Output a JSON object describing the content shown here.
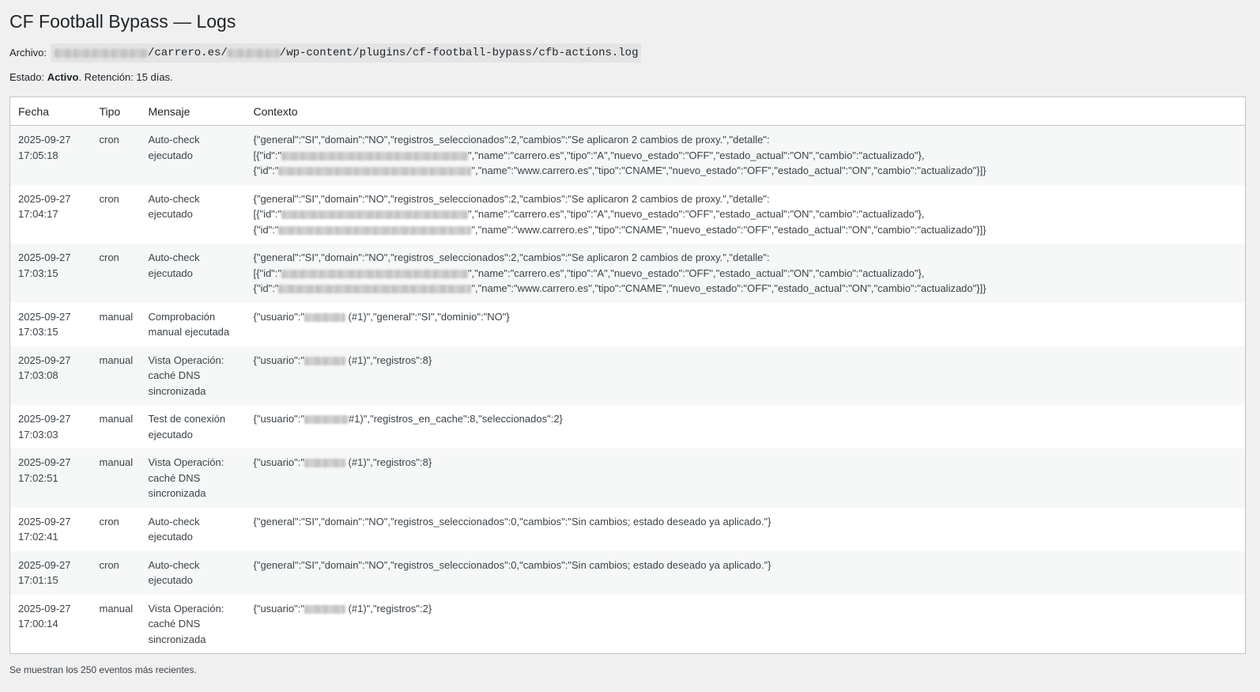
{
  "page": {
    "title": "CF Football Bypass — Logs",
    "file_label": "Archivo:",
    "file_path_part1": "/carrero.es/",
    "file_path_part2": "/wp-content/plugins/cf-football-bypass/cfb-actions.log",
    "status_label": "Estado: ",
    "status_value": "Activo",
    "retention_text": ". Retención: 15 días.",
    "footer_note": "Se muestran los 250 eventos más recientes."
  },
  "table": {
    "headers": {
      "fecha": "Fecha",
      "tipo": "Tipo",
      "mensaje": "Mensaje",
      "contexto": "Contexto"
    },
    "rows": [
      {
        "date": "2025-09-27",
        "time": "17:05:18",
        "tipo": "cron",
        "mensaje": "Auto-check ejecutado",
        "ctx1": "{\"general\":\"SI\",\"domain\":\"NO\",\"registros_seleccionados\":2,\"cambios\":\"Se aplicaron 2 cambios de proxy.\",\"detalle\":",
        "ctx2a": "[{\"id\":\"",
        "ctx2b": "\",\"name\":\"carrero.es\",\"tipo\":\"A\",\"nuevo_estado\":\"OFF\",\"estado_actual\":\"ON\",\"cambio\":\"actualizado\"},",
        "ctx3a": "{\"id\":\"",
        "ctx3b": "\",\"name\":\"www.carrero.es\",\"tipo\":\"CNAME\",\"nuevo_estado\":\"OFF\",\"estado_actual\":\"ON\",\"cambio\":\"actualizado\"}]}"
      },
      {
        "date": "2025-09-27",
        "time": "17:04:17",
        "tipo": "cron",
        "mensaje": "Auto-check ejecutado",
        "ctx1": "{\"general\":\"SI\",\"domain\":\"NO\",\"registros_seleccionados\":2,\"cambios\":\"Se aplicaron 2 cambios de proxy.\",\"detalle\":",
        "ctx2a": "[{\"id\":\"",
        "ctx2b": "\",\"name\":\"carrero.es\",\"tipo\":\"A\",\"nuevo_estado\":\"OFF\",\"estado_actual\":\"ON\",\"cambio\":\"actualizado\"},",
        "ctx3a": "{\"id\":\"",
        "ctx3b": "\",\"name\":\"www.carrero.es\",\"tipo\":\"CNAME\",\"nuevo_estado\":\"OFF\",\"estado_actual\":\"ON\",\"cambio\":\"actualizado\"}]}"
      },
      {
        "date": "2025-09-27",
        "time": "17:03:15",
        "tipo": "cron",
        "mensaje": "Auto-check ejecutado",
        "ctx1": "{\"general\":\"SI\",\"domain\":\"NO\",\"registros_seleccionados\":2,\"cambios\":\"Se aplicaron 2 cambios de proxy.\",\"detalle\":",
        "ctx2a": "[{\"id\":\"",
        "ctx2b": "\",\"name\":\"carrero.es\",\"tipo\":\"A\",\"nuevo_estado\":\"OFF\",\"estado_actual\":\"ON\",\"cambio\":\"actualizado\"},",
        "ctx3a": "{\"id\":\"",
        "ctx3b": "\",\"name\":\"www.carrero.es\",\"tipo\":\"CNAME\",\"nuevo_estado\":\"OFF\",\"estado_actual\":\"ON\",\"cambio\":\"actualizado\"}]}"
      },
      {
        "date": "2025-09-27",
        "time": "17:03:15",
        "tipo": "manual",
        "mensaje": "Comprobación manual ejecutada",
        "ctx1": "{\"usuario\":\"",
        "ctx1b": " (#1)\",\"general\":\"SI\",\"dominio\":\"NO\"}"
      },
      {
        "date": "2025-09-27",
        "time": "17:03:08",
        "tipo": "manual",
        "mensaje": "Vista Operación: caché DNS sincronizada",
        "ctx1": "{\"usuario\":\"",
        "ctx1b": " (#1)\",\"registros\":8}"
      },
      {
        "date": "2025-09-27",
        "time": "17:03:03",
        "tipo": "manual",
        "mensaje": "Test de conexión ejecutado",
        "ctx1": "{\"usuario\":\"",
        "ctx1b": "#1)\",\"registros_en_cache\":8,\"seleccionados\":2}"
      },
      {
        "date": "2025-09-27",
        "time": "17:02:51",
        "tipo": "manual",
        "mensaje": "Vista Operación: caché DNS sincronizada",
        "ctx1": "{\"usuario\":\"",
        "ctx1b": " (#1)\",\"registros\":8}"
      },
      {
        "date": "2025-09-27",
        "time": "17:02:41",
        "tipo": "cron",
        "mensaje": "Auto-check ejecutado",
        "ctx1": "{\"general\":\"SI\",\"domain\":\"NO\",\"registros_seleccionados\":0,\"cambios\":\"Sin cambios; estado deseado ya aplicado.\"}"
      },
      {
        "date": "2025-09-27",
        "time": "17:01:15",
        "tipo": "cron",
        "mensaje": "Auto-check ejecutado",
        "ctx1": "{\"general\":\"SI\",\"domain\":\"NO\",\"registros_seleccionados\":0,\"cambios\":\"Sin cambios; estado deseado ya aplicado.\"}"
      },
      {
        "date": "2025-09-27",
        "time": "17:00:14",
        "tipo": "manual",
        "mensaje": "Vista Operación: caché DNS sincronizada",
        "ctx1": "{\"usuario\":\"",
        "ctx1b": " (#1)\",\"registros\":2}"
      }
    ]
  }
}
